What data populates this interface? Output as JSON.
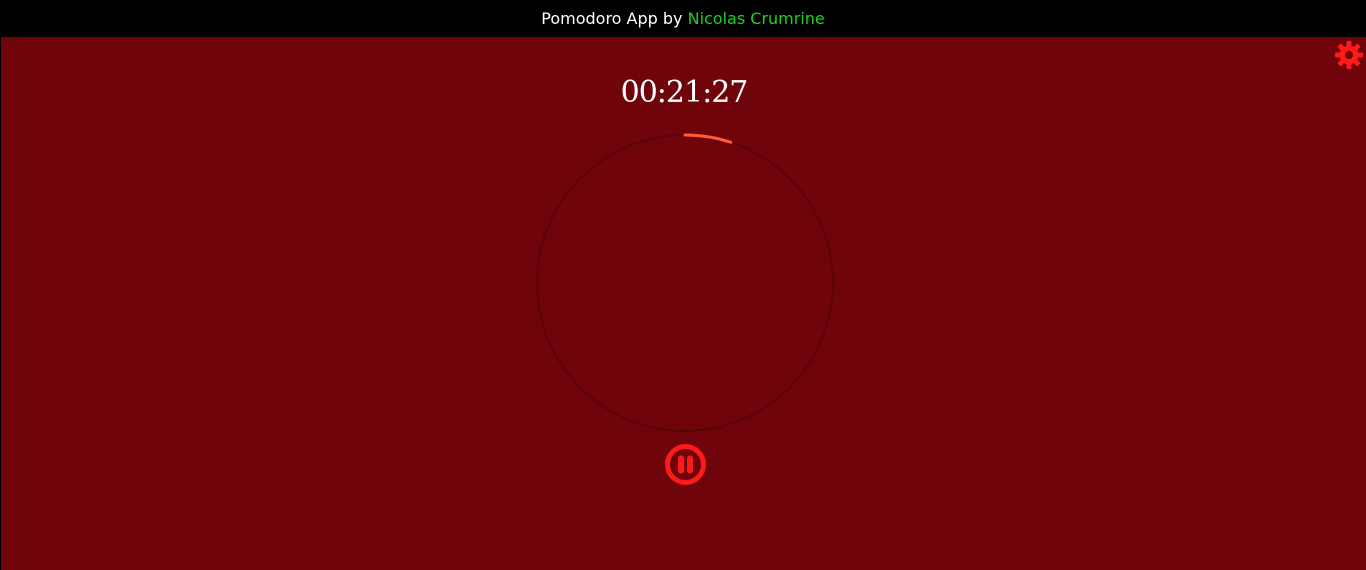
{
  "header": {
    "title_prefix": "Pomodoro App by ",
    "author": "Nicolas Crumrine"
  },
  "timer": {
    "display": "00:21:27",
    "progress": 0.05
  },
  "controls": {
    "settings_icon": "gear-icon",
    "pause_icon": "pause-icon"
  },
  "colors": {
    "background": "#6f050b",
    "header_bg": "#000000",
    "author_link": "#1fcf1f",
    "ring_track": "#5a0309",
    "ring_progress": "#ff5c3a",
    "control_red": "#ff1a1a"
  }
}
